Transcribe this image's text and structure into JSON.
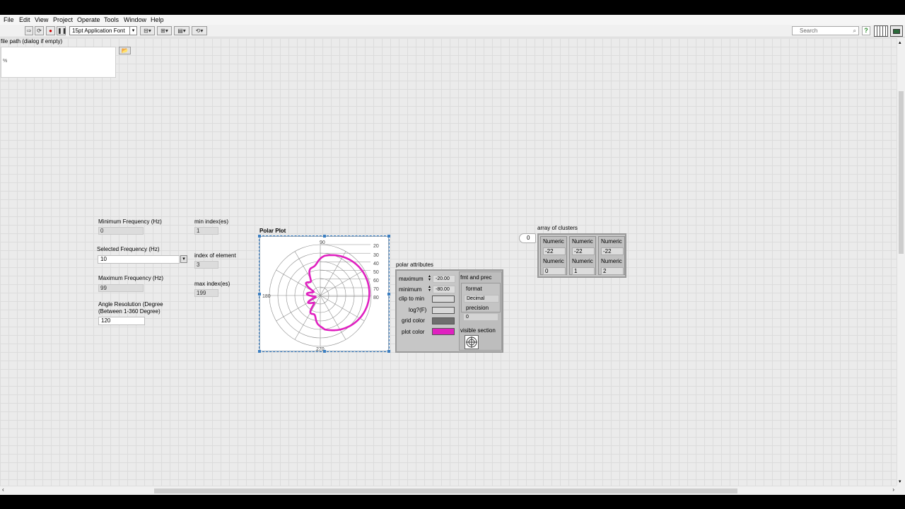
{
  "menu": [
    "File",
    "Edit",
    "View",
    "Project",
    "Operate",
    "Tools",
    "Window",
    "Help"
  ],
  "toolbar": {
    "font": "15pt Application Font",
    "search_placeholder": "Search",
    "help": "?"
  },
  "file_path": {
    "label": "file path (dialog if empty)"
  },
  "controls": {
    "min_freq_label": "Minimum Frequency (Hz)",
    "min_freq_value": "0",
    "sel_freq_label": "Selected Frequency (Hz)",
    "sel_freq_value": "10",
    "max_freq_label": "Maximum Frequency (Hz)",
    "max_freq_value": "99",
    "angle_label_1": "Angle Resolution (Degree",
    "angle_label_2": "(Between 1-360 Degree)",
    "angle_value": "120",
    "min_index_label": "min index(es)",
    "min_index_value": "1",
    "index_elem_label": "index of element",
    "index_elem_value": "3",
    "max_index_label": "max index(es)",
    "max_index_value": "199"
  },
  "polar_plot": {
    "title": "Polar Plot",
    "angle_labels": [
      "90",
      "180",
      "270"
    ],
    "ring_labels": [
      "20",
      "30",
      "40",
      "50",
      "60",
      "70",
      "80"
    ],
    "plot_color": "#e020c0"
  },
  "polar_attributes": {
    "title": "polar attributes",
    "maximum_label": "maximum",
    "maximum_value": "-20.00",
    "minimum_label": "minimum",
    "minimum_value": "-80.00",
    "clip_label": "clip to min",
    "log_label": "log?(F)",
    "grid_label": "grid color",
    "plot_label": "plot color",
    "grid_color": "#6e6e6e",
    "plot_color": "#e020c0",
    "fmt_title": "fmt and prec",
    "format_label": "format",
    "format_value": "Decimal",
    "precision_label": "precision",
    "precision_value": "0",
    "visible_label": "visible section"
  },
  "array": {
    "title": "array of clusters",
    "index": "0",
    "header": "Numeric",
    "cells": [
      {
        "a": "-22",
        "b": "0"
      },
      {
        "a": "-22",
        "b": "1"
      },
      {
        "a": "-22",
        "b": "2"
      }
    ]
  }
}
